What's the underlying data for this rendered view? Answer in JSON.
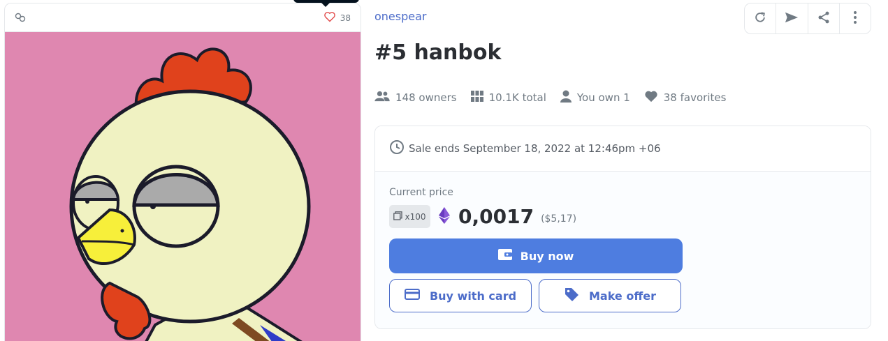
{
  "card": {
    "favorites_count": "38"
  },
  "collection": {
    "name": "onespear"
  },
  "asset": {
    "title": "#5 hanbok"
  },
  "stats": {
    "owners": "148 owners",
    "total": "10.1K total",
    "you_own": "You own 1",
    "favorites": "38 favorites"
  },
  "sale": {
    "ends_text": "Sale ends September 18, 2022 at 12:46pm +06",
    "current_price_label": "Current price",
    "quantity": "x100",
    "price": "0,0017",
    "price_usd": "($5,17)",
    "buy_now_label": "Buy now",
    "buy_card_label": "Buy with card",
    "make_offer_label": "Make offer"
  },
  "colors": {
    "accent": "#4e7de0",
    "link": "#4c6cc9",
    "art_background": "#df87b0"
  },
  "icons": [
    "chain-icon",
    "heart-icon",
    "refresh-icon",
    "send-icon",
    "share-icon",
    "more-icon",
    "owners-icon",
    "grid-icon",
    "person-icon",
    "heart-filled-icon",
    "clock-icon",
    "copies-icon",
    "eth-icon",
    "wallet-icon",
    "card-icon",
    "tag-icon"
  ]
}
